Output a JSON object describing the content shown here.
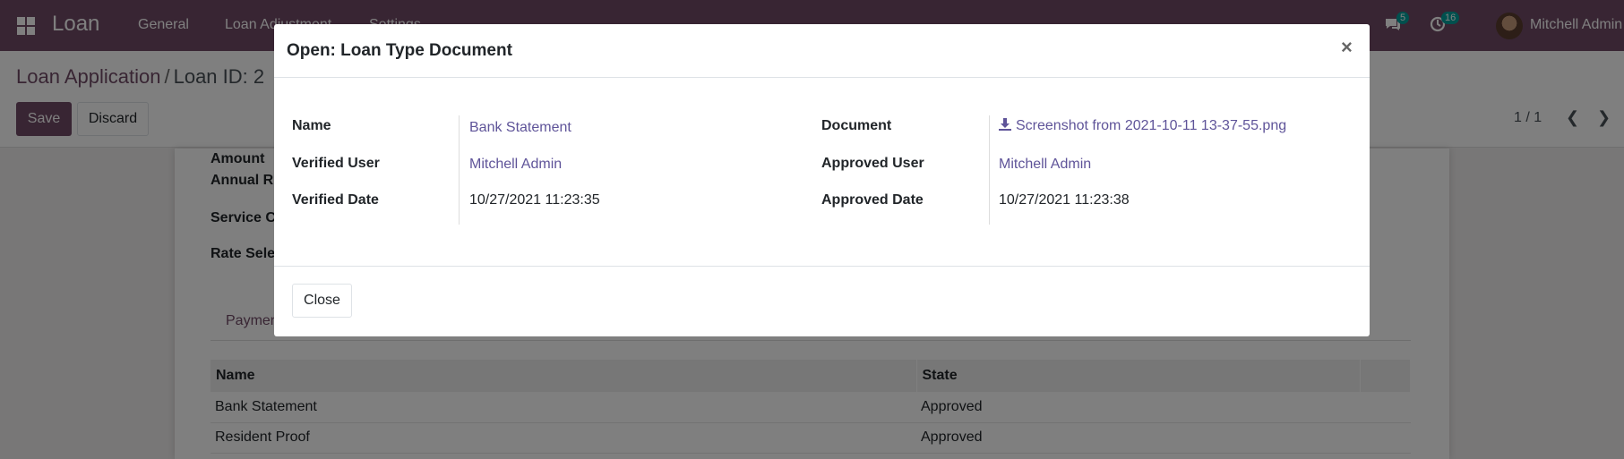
{
  "navbar": {
    "brand": "Loan",
    "menu": [
      "General",
      "Loan Adjustment",
      "Settings"
    ],
    "messages_badge": "5",
    "activities_badge": "16",
    "user_name": "Mitchell Admin"
  },
  "control_panel": {
    "breadcrumb_parent": "Loan Application",
    "breadcrumb_separator": "/",
    "breadcrumb_current": "Loan ID: 2",
    "save_label": "Save",
    "discard_label": "Discard",
    "pager": "1 / 1"
  },
  "form": {
    "labels": [
      "Amount",
      "Annual R",
      "Service C",
      "Rate Sele"
    ],
    "tab_label": "Paymen",
    "table": {
      "columns": [
        "Name",
        "State"
      ],
      "rows": [
        {
          "name": "Bank Statement",
          "state": "Approved"
        },
        {
          "name": "Resident Proof",
          "state": "Approved"
        }
      ]
    }
  },
  "modal": {
    "title": "Open: Loan Type Document",
    "close_symbol": "×",
    "left_fields": [
      {
        "label": "Name",
        "value": "Bank Statement"
      },
      {
        "label": "Verified User",
        "value": "Mitchell Admin"
      },
      {
        "label": "Verified Date",
        "value": "10/27/2021 11:23:35"
      }
    ],
    "right_fields": [
      {
        "label": "Document",
        "value": "Screenshot from 2021-10-11 13-37-55.png"
      },
      {
        "label": "Approved User",
        "value": "Mitchell Admin"
      },
      {
        "label": "Approved Date",
        "value": "10/27/2021 11:23:38"
      }
    ],
    "close_button_label": "Close"
  },
  "colors": {
    "brand": "#714b67",
    "link": "#5f5499",
    "badge": "#00a09d"
  }
}
